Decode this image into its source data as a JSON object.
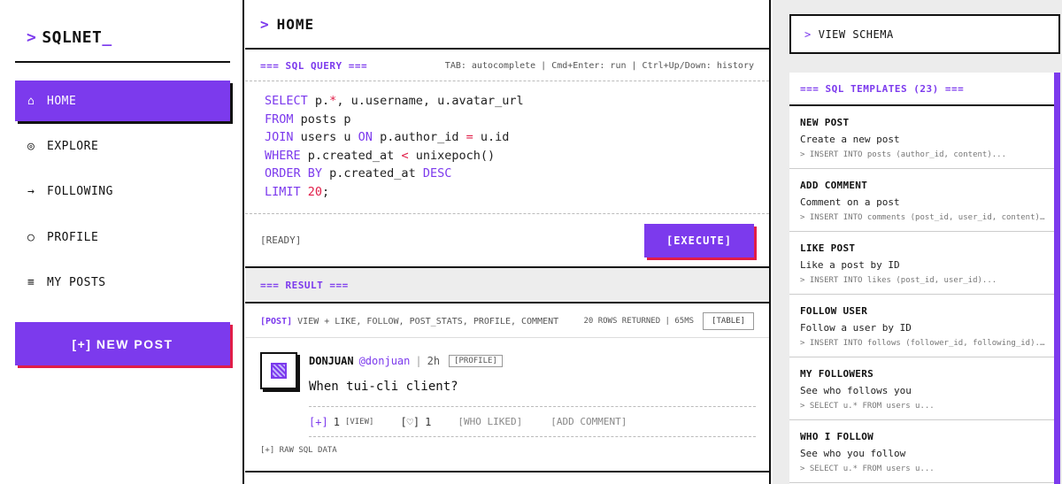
{
  "logo": {
    "prompt": ">",
    "name": "SQLNET",
    "cursor": "_"
  },
  "nav": [
    {
      "icon": "⌂",
      "icon_name": "home-icon",
      "label": "HOME",
      "active": true
    },
    {
      "icon": "◎",
      "icon_name": "explore-icon",
      "label": "EXPLORE",
      "active": false
    },
    {
      "icon": "→",
      "icon_name": "arrow-right-icon",
      "label": "FOLLOWING",
      "active": false
    },
    {
      "icon": "○",
      "icon_name": "profile-icon",
      "label": "PROFILE",
      "active": false
    },
    {
      "icon": "≡",
      "icon_name": "list-icon",
      "label": "MY POSTS",
      "active": false
    }
  ],
  "new_post_label": "[+] NEW POST",
  "page": {
    "prompt": ">",
    "title": "HOME"
  },
  "query": {
    "title": "=== SQL QUERY ===",
    "hint": "TAB: autocomplete | Cmd+Enter: run | Ctrl+Up/Down: history",
    "status": "[READY]",
    "execute_label": "[EXECUTE]",
    "lines": [
      [
        {
          "t": "SELECT",
          "c": "kw"
        },
        {
          "t": " p.",
          "c": ""
        },
        {
          "t": "*",
          "c": "op"
        },
        {
          "t": ", u.username, u.avatar_url",
          "c": ""
        }
      ],
      [
        {
          "t": "FROM",
          "c": "kw"
        },
        {
          "t": " posts p",
          "c": ""
        }
      ],
      [
        {
          "t": "JOIN",
          "c": "kw"
        },
        {
          "t": " users u ",
          "c": ""
        },
        {
          "t": "ON",
          "c": "kw"
        },
        {
          "t": " p.author_id ",
          "c": ""
        },
        {
          "t": "=",
          "c": "op"
        },
        {
          "t": " u.id",
          "c": ""
        }
      ],
      [
        {
          "t": "WHERE",
          "c": "kw"
        },
        {
          "t": " p.created_at ",
          "c": ""
        },
        {
          "t": "<",
          "c": "op"
        },
        {
          "t": " unixepoch()",
          "c": ""
        }
      ],
      [
        {
          "t": "ORDER BY",
          "c": "kw"
        },
        {
          "t": " p.created_at ",
          "c": ""
        },
        {
          "t": "DESC",
          "c": "kw"
        }
      ],
      [
        {
          "t": "LIMIT",
          "c": "kw"
        },
        {
          "t": " ",
          "c": ""
        },
        {
          "t": "20",
          "c": "num"
        },
        {
          "t": ";",
          "c": ""
        }
      ]
    ]
  },
  "result": {
    "title": "=== RESULT ===",
    "tag": "[POST]",
    "description": "VIEW + LIKE, FOLLOW, POST_STATS, PROFILE, COMMENT",
    "rows_info": "20 ROWS RETURNED | 65MS",
    "view_mode": "[TABLE]"
  },
  "post": {
    "author": "DONJUAN",
    "handle": "@donjuan",
    "separator": "|",
    "ago": "2h",
    "profile_label": "[PROFILE]",
    "content": "When tui-cli client?",
    "view_prefix": "[+]",
    "view_count": "1",
    "view_label": "[VIEW]",
    "like_icon": "[♡]",
    "like_count": "1",
    "who_liked": "[WHO LIKED]",
    "add_comment": "[ADD COMMENT]"
  },
  "raw_sql_label": "[+] RAW SQL DATA",
  "schema": {
    "prompt": ">",
    "label": "VIEW SCHEMA"
  },
  "templates": {
    "title": "=== SQL TEMPLATES (23) ===",
    "items": [
      {
        "title": "NEW POST",
        "desc": "Create a new post",
        "sql": "> INSERT INTO posts (author_id, content)..."
      },
      {
        "title": "ADD COMMENT",
        "desc": "Comment on a post",
        "sql": "> INSERT INTO comments (post_id, user_id, content)..."
      },
      {
        "title": "LIKE POST",
        "desc": "Like a post by ID",
        "sql": "> INSERT INTO likes (post_id, user_id)..."
      },
      {
        "title": "FOLLOW USER",
        "desc": "Follow a user by ID",
        "sql": "> INSERT INTO follows (follower_id, following_id)..."
      },
      {
        "title": "MY FOLLOWERS",
        "desc": "See who follows you",
        "sql": "> SELECT u.* FROM users u..."
      },
      {
        "title": "WHO I FOLLOW",
        "desc": "See who you follow",
        "sql": "> SELECT u.* FROM users u..."
      }
    ]
  },
  "colors": {
    "accent": "#7c3aed",
    "accent_shadow": "#e11d48",
    "ink": "#111111",
    "panel_bg": "#ececec"
  }
}
